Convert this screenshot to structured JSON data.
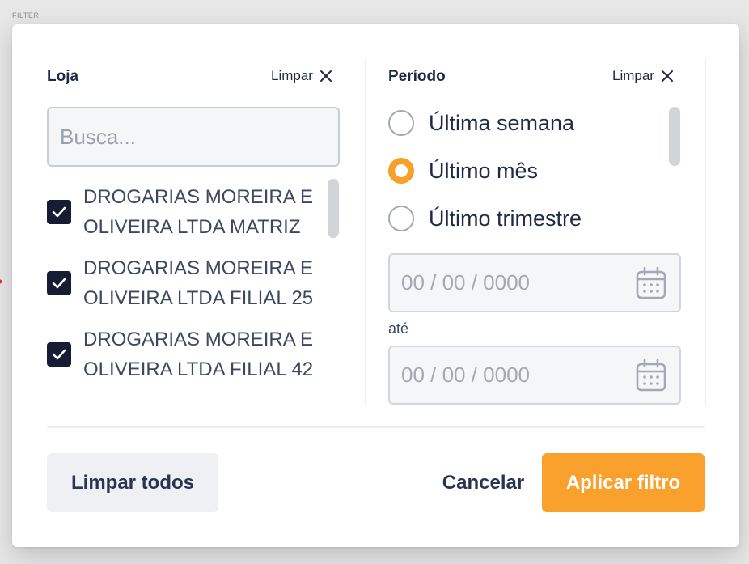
{
  "frame_label": "FILTER",
  "store_section": {
    "title": "Loja",
    "clear_label": "Limpar",
    "search_placeholder": "Busca...",
    "items": [
      {
        "label": "DROGARIAS MOREIRA E OLIVEIRA LTDA MATRIZ",
        "checked": true
      },
      {
        "label": "DROGARIAS MOREIRA E OLIVEIRA LTDA FILIAL 25",
        "checked": true
      },
      {
        "label": "DROGARIAS MOREIRA E OLIVEIRA LTDA FILIAL 42",
        "checked": true
      }
    ]
  },
  "period_section": {
    "title": "Período",
    "clear_label": "Limpar",
    "options": [
      {
        "label": "Última semana",
        "selected": false
      },
      {
        "label": "Último mês",
        "selected": true
      },
      {
        "label": "Último trimestre",
        "selected": false
      }
    ],
    "date_from_placeholder": "00 / 00 / 0000",
    "between_label": "até",
    "date_to_placeholder": "00 / 00 / 0000"
  },
  "footer": {
    "clear_all_label": "Limpar todos",
    "cancel_label": "Cancelar",
    "apply_label": "Aplicar filtro"
  },
  "colors": {
    "accent": "#f9a12c",
    "checkbox": "#151c33",
    "text_primary": "#1f2a44",
    "placeholder": "#9aa1ab"
  },
  "icons": {
    "clear": "close-icon",
    "checkbox": "checkmark-icon",
    "date": "calendar-icon",
    "side_indicator": "arrow-right-icon"
  }
}
